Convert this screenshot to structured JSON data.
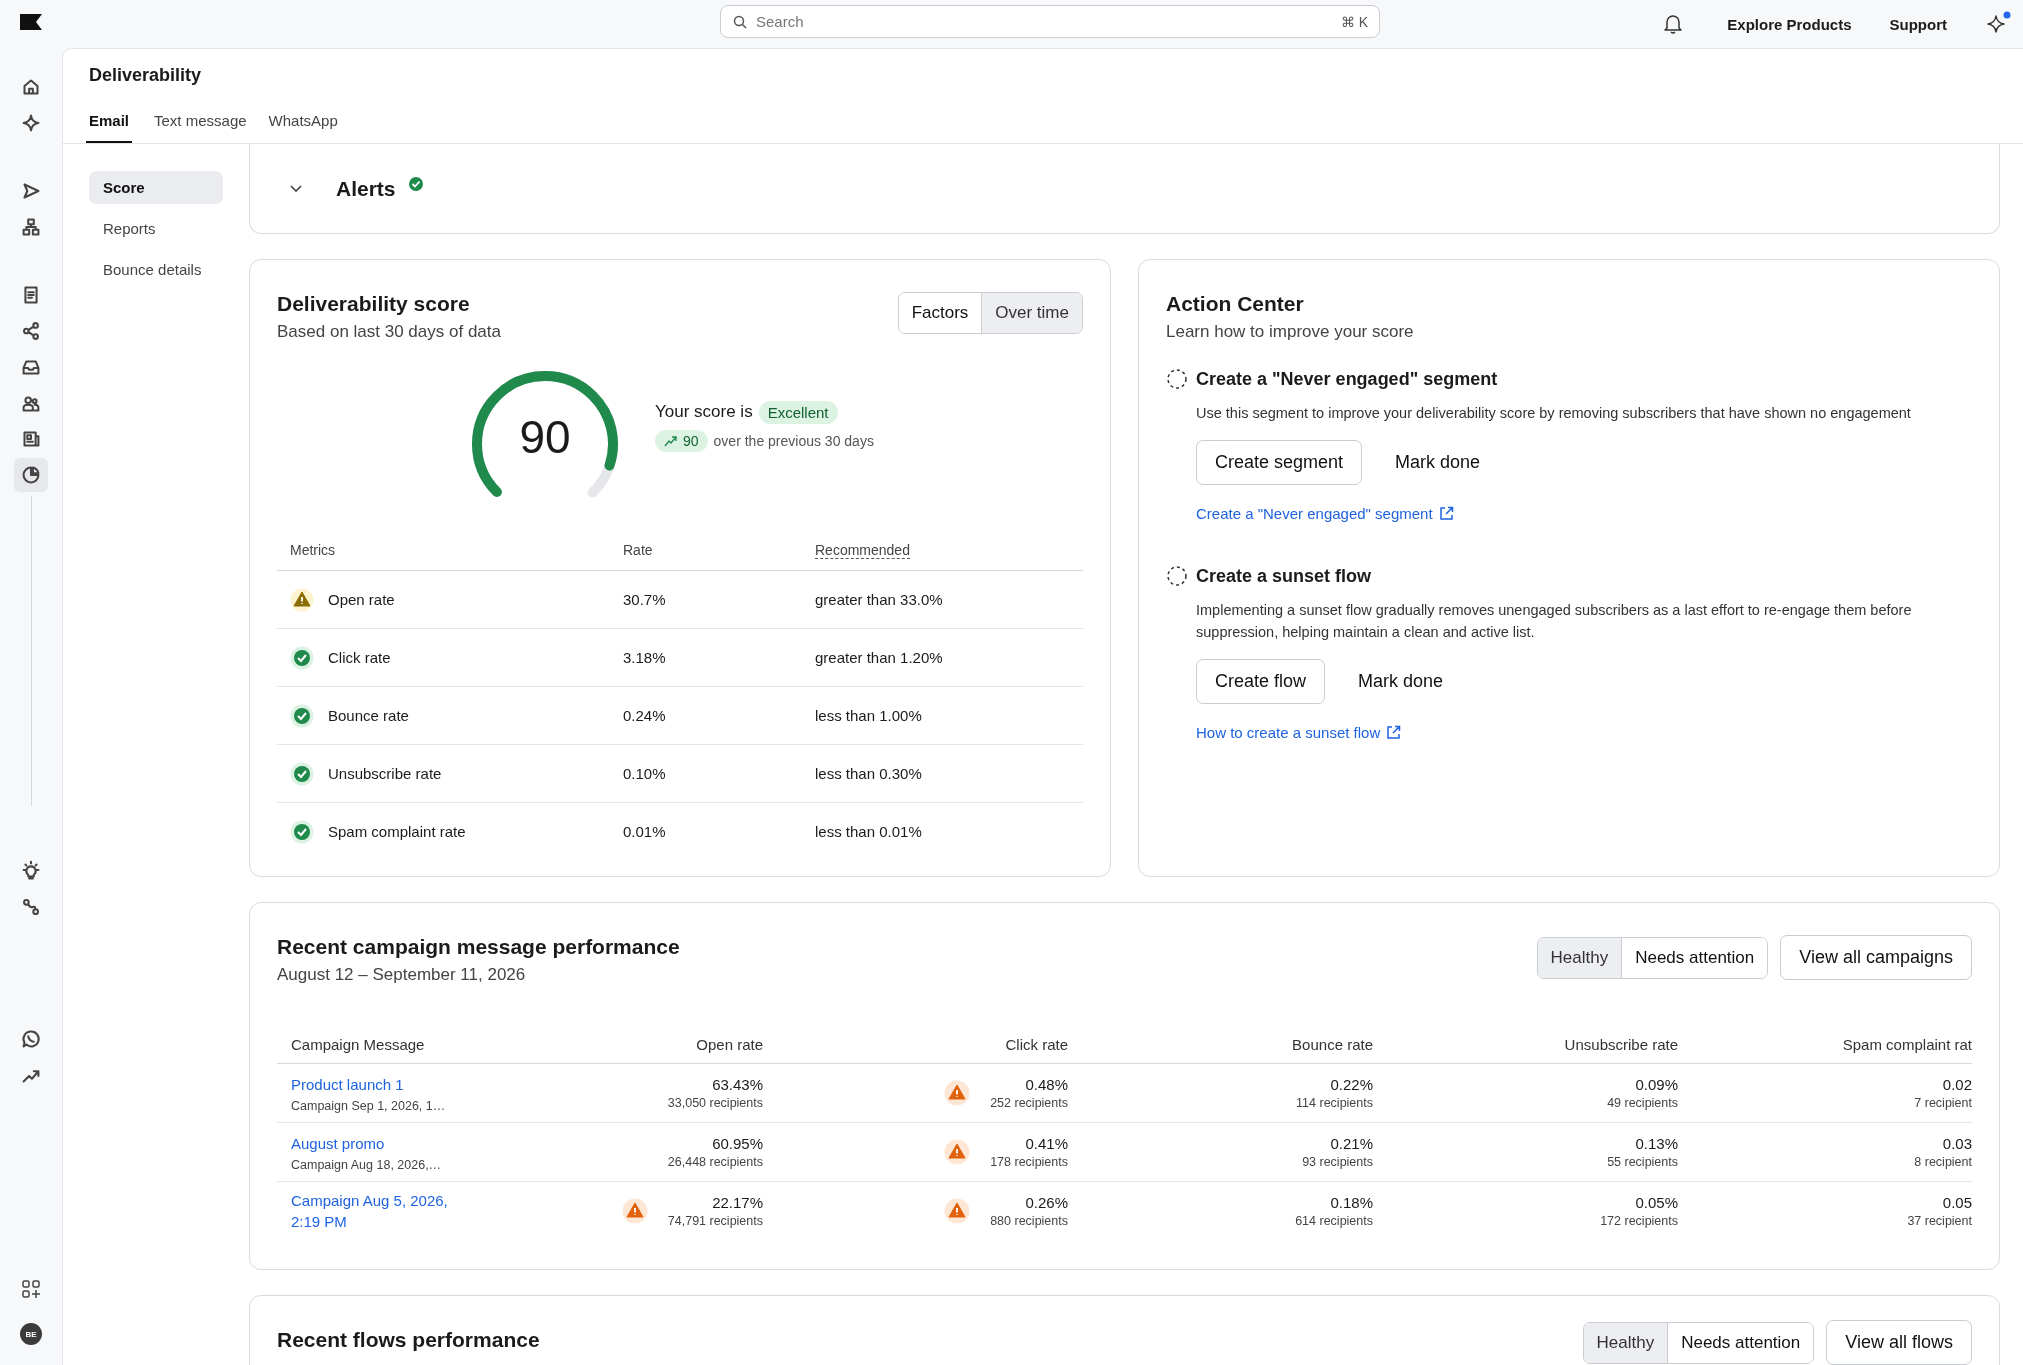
{
  "rail": [
    {
      "kind": "home",
      "selected": false
    },
    {
      "kind": "sparkle",
      "selected": false
    },
    {
      "kind": "send",
      "selected": false
    },
    {
      "kind": "hierarchy",
      "selected": false
    },
    {
      "kind": "list",
      "selected": false
    },
    {
      "kind": "share",
      "selected": false
    },
    {
      "kind": "inbox",
      "selected": false
    },
    {
      "kind": "people",
      "selected": false
    },
    {
      "kind": "news",
      "selected": false
    },
    {
      "kind": "pie",
      "selected": true
    }
  ],
  "rail_bottom": [
    {
      "kind": "bulb"
    },
    {
      "kind": "route"
    },
    {
      "kind": "chat"
    },
    {
      "kind": "trend"
    }
  ],
  "rail_footer": {
    "avatar": "BE"
  },
  "topbar": {
    "search": {
      "placeholder": "Search",
      "shortcut": "⌘ K"
    },
    "notifications_unread": true,
    "links": [
      "Explore Products",
      "Support"
    ]
  },
  "page": {
    "title": "Deliverability",
    "tabs": [
      {
        "label": "Email",
        "selected": true
      },
      {
        "label": "Text message",
        "selected": false
      },
      {
        "label": "WhatsApp",
        "selected": false
      }
    ]
  },
  "subnav": [
    {
      "label": "Score",
      "selected": true
    },
    {
      "label": "Reports",
      "selected": false
    },
    {
      "label": "Bounce details",
      "selected": false
    }
  ],
  "alerts": {
    "title": "Alerts",
    "all_clear": true,
    "expanded": false
  },
  "score_card": {
    "title": "Deliverability score",
    "subtitle": "Based on last 30 days of data",
    "toggle": [
      {
        "label": "Factors",
        "selected": true
      },
      {
        "label": "Over time",
        "selected": false
      }
    ],
    "score": "90",
    "level": 0.9,
    "score_label": "Your score is",
    "badge": "Excellent",
    "trend_value": "90",
    "trend_text": "over the previous 30 days",
    "columns": [
      "Metrics",
      "Rate",
      "Recommended"
    ],
    "metrics": [
      {
        "name": "Open rate",
        "warning": true,
        "rate": "30.7%",
        "recommended": "greater than 33.0%"
      },
      {
        "name": "Click rate",
        "warning": false,
        "rate": "3.18%",
        "recommended": "greater than 1.20%"
      },
      {
        "name": "Bounce rate",
        "warning": false,
        "rate": "0.24%",
        "recommended": "less than 1.00%"
      },
      {
        "name": "Unsubscribe rate",
        "warning": false,
        "rate": "0.10%",
        "recommended": "less than 0.30%"
      },
      {
        "name": "Spam complaint rate",
        "warning": false,
        "rate": "0.01%",
        "recommended": "less than 0.01%"
      }
    ]
  },
  "action_center": {
    "title": "Action Center",
    "subtitle": "Learn how to improve your score",
    "actions": [
      {
        "title": "Create a \"Never engaged\" segment",
        "done": false,
        "description": "Use this segment to improve your deliverability score by removing subscribers that have shown no engagement",
        "button": "Create segment",
        "secondary": "Mark done",
        "link": "Create a \"Never engaged\" segment"
      },
      {
        "title": "Create a sunset flow",
        "done": false,
        "description": "Implementing a sunset flow gradually removes unengaged subscribers as a last effort to re-engage them before suppression, helping maintain a clean and active list.",
        "button": "Create flow",
        "secondary": "Mark done",
        "link": "How to create a sunset flow"
      }
    ]
  },
  "campaigns": {
    "title": "Recent campaign message performance",
    "subtitle": "August 12 – September 11, 2026",
    "toggle": [
      {
        "label": "Healthy",
        "selected": false
      },
      {
        "label": "Needs attention",
        "selected": true
      }
    ],
    "button": "View all campaigns",
    "name_column": "Campaign Message",
    "metric_columns": [
      "Open rate",
      "Click rate",
      "Bounce rate",
      "Unsubscribe rate",
      "Spam complaint rat"
    ],
    "rows": [
      {
        "name": "Product launch 1",
        "detail": "Campaign Sep 1, 2026, 1…",
        "cells": [
          {
            "rate": "63.43%",
            "recipients": "33,050 recipients",
            "warning": false
          },
          {
            "rate": "0.48%",
            "recipients": "252 recipients",
            "warning": true
          },
          {
            "rate": "0.22%",
            "recipients": "114 recipients",
            "warning": false
          },
          {
            "rate": "0.09%",
            "recipients": "49 recipients",
            "warning": false
          },
          {
            "rate": "0.02",
            "recipients": "7 recipient",
            "warning": false
          }
        ]
      },
      {
        "name": "August promo",
        "detail": "Campaign Aug 18, 2026,…",
        "cells": [
          {
            "rate": "60.95%",
            "recipients": "26,448 recipients",
            "warning": false
          },
          {
            "rate": "0.41%",
            "recipients": "178 recipients",
            "warning": true
          },
          {
            "rate": "0.21%",
            "recipients": "93 recipients",
            "warning": false
          },
          {
            "rate": "0.13%",
            "recipients": "55 recipients",
            "warning": false
          },
          {
            "rate": "0.03",
            "recipients": "8 recipient",
            "warning": false
          }
        ]
      },
      {
        "name": "Campaign Aug 5, 2026, 2:19 PM",
        "cells": [
          {
            "rate": "22.17%",
            "recipients": "74,791 recipients",
            "warning": true
          },
          {
            "rate": "0.26%",
            "recipients": "880 recipients",
            "warning": true
          },
          {
            "rate": "0.18%",
            "recipients": "614 recipients",
            "warning": false
          },
          {
            "rate": "0.05%",
            "recipients": "172 recipients",
            "warning": false
          },
          {
            "rate": "0.05",
            "recipients": "37 recipient",
            "warning": false
          }
        ]
      }
    ]
  },
  "flows": {
    "title": "Recent flows performance",
    "toggle": [
      {
        "label": "Healthy",
        "selected": false
      },
      {
        "label": "Needs attention",
        "selected": true
      }
    ],
    "button": "View all flows"
  }
}
